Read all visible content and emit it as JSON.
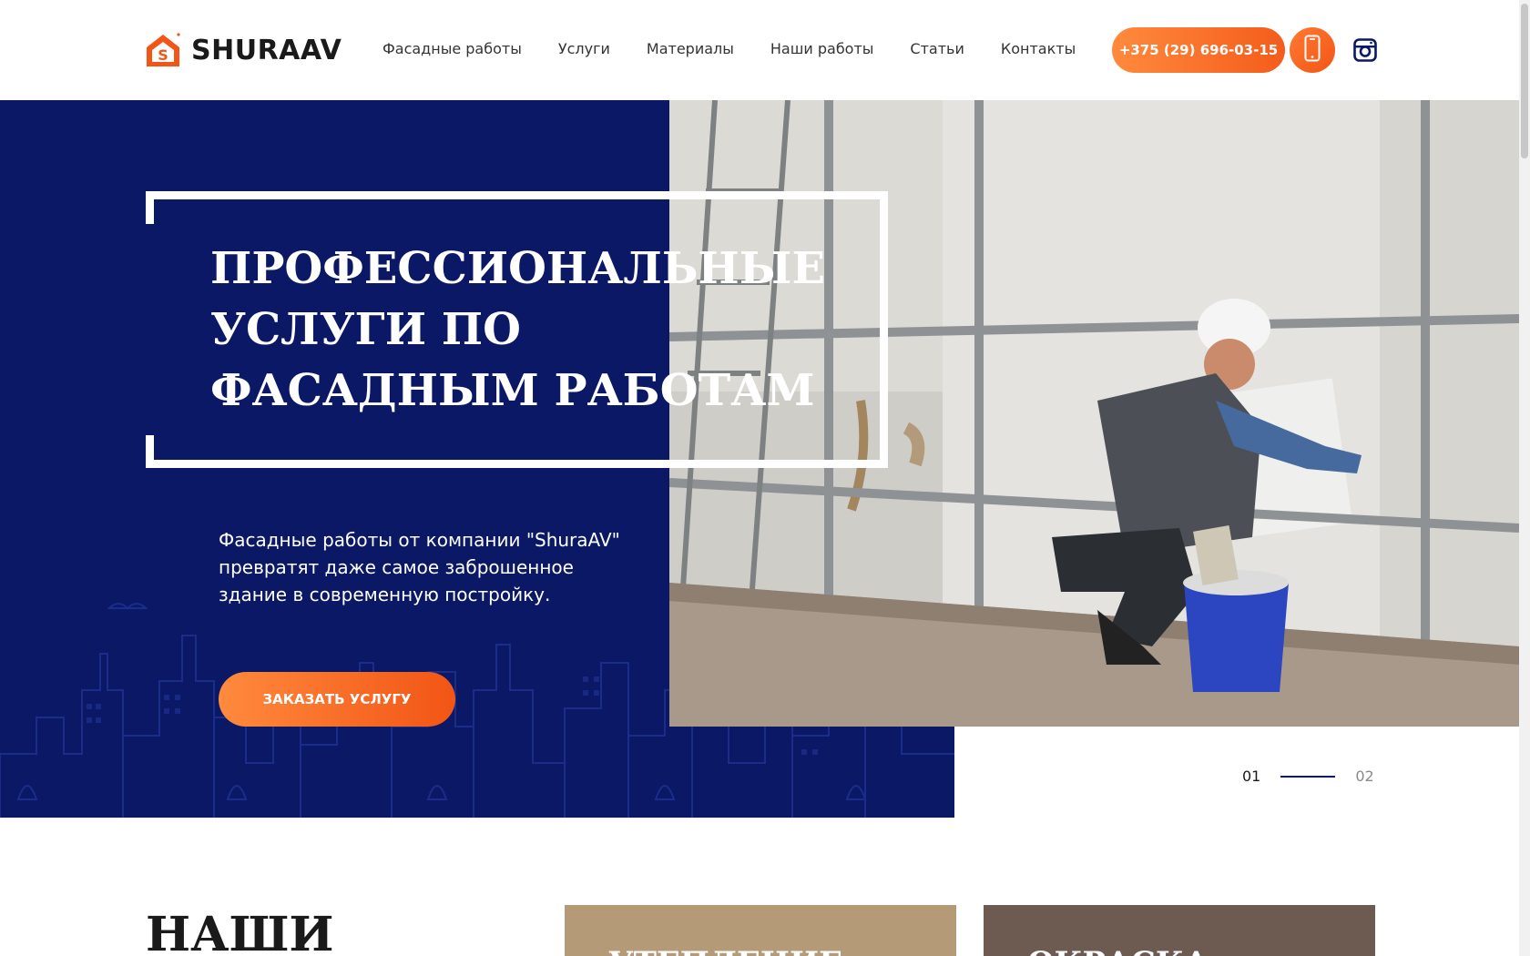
{
  "header": {
    "brand": "SHURAAV",
    "nav": [
      "Фасадные работы",
      "Услуги",
      "Материалы",
      "Наши работы",
      "Статьи",
      "Контакты"
    ],
    "phone": "+375 (29) 696-03-15",
    "icons": {
      "logo": "house-s-logo-icon",
      "mobile": "mobile-phone-icon",
      "social": "instagram-icon"
    }
  },
  "hero": {
    "title": "ПРОФЕССИОНАЛЬНЫЕ УСЛУГИ ПО ФАСАДНЫМ РАБОТАМ",
    "description": "Фасадные работы от компании \"ShuraAV\" превратят даже самое заброшенное здание в современную постройку.",
    "cta": "ЗАКАЗАТЬ УСЛУГУ"
  },
  "slider": {
    "current": "01",
    "next": "02"
  },
  "section": {
    "title": "НАШИ",
    "cards": [
      "УТЕПЛЕНИЕ",
      "ОКРАСКА"
    ]
  },
  "colors": {
    "navy": "#0a1866",
    "accent": "#f45c1c",
    "accent_light": "#ff8a3d"
  }
}
